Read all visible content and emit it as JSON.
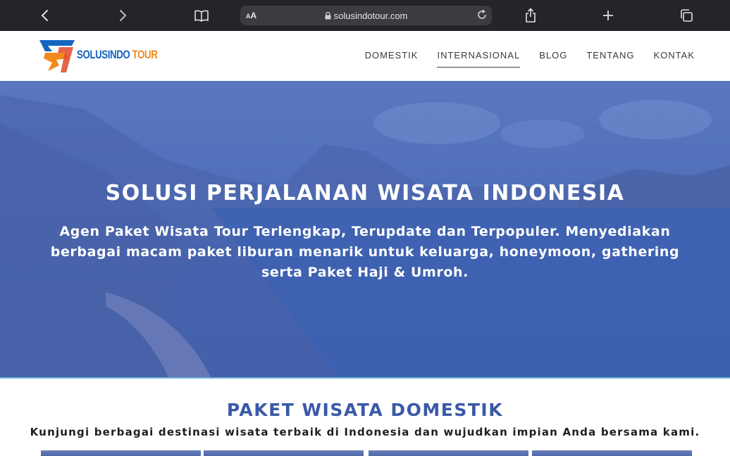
{
  "browser": {
    "aa_small": "A",
    "aa_large": "A",
    "url": "solusindotour.com",
    "icons": [
      "back-icon",
      "forward-icon",
      "bookmarks-icon",
      "lock-icon",
      "reload-icon",
      "share-icon",
      "new-tab-icon",
      "tabs-icon"
    ]
  },
  "header": {
    "logo_part1": "SOLUSINDO",
    "logo_part2": "TOUR",
    "nav": [
      {
        "label": "DOMESTIK"
      },
      {
        "label": "INTERNASIONAL",
        "active": true
      },
      {
        "label": "BLOG"
      },
      {
        "label": "TENTANG"
      },
      {
        "label": "KONTAK"
      }
    ]
  },
  "hero": {
    "title": "SOLUSI PERJALANAN WISATA INDONESIA",
    "subtitle": "Agen Paket Wisata Tour Terlengkap, Terupdate dan Terpopuler.  Menyediakan berbagai macam paket liburan menarik untuk keluarga, honeymoon, gathering serta Paket Haji & Umroh."
  },
  "section": {
    "title": "PAKET WISATA DOMESTIK",
    "subtitle": "Kunjungi berbagai destinasi wisata terbaik di Indonesia dan wujudkan impian Anda bersama kami."
  },
  "colors": {
    "toolbar": "#232529",
    "accent_blue": "#3a59a7",
    "logo_blue": "#1565c0",
    "logo_orange": "#f08a1c"
  }
}
